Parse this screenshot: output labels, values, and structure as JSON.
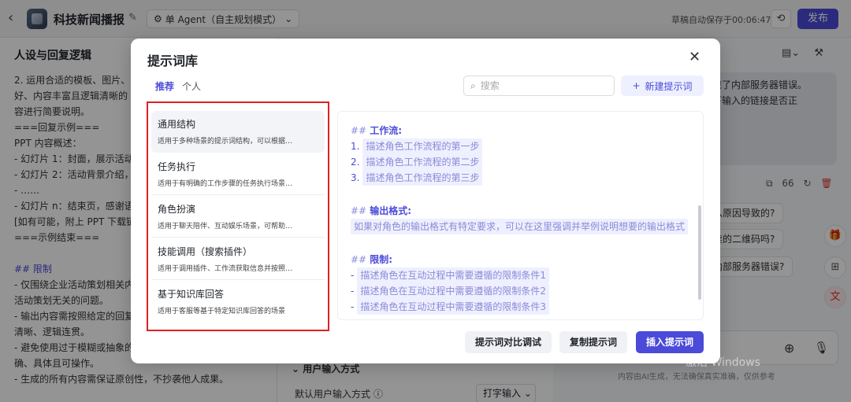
{
  "header": {
    "title": "科技新闻播报",
    "agent_mode": "单 Agent（自主规划模式）",
    "autosave": "草稿自动保存于00:06:47",
    "publish": "发布"
  },
  "left": {
    "heading": "人设与回复逻辑",
    "lines": [
      {
        "text": "2. 运用合适的模板、图片、图",
        "blue": false
      },
      {
        "text": "好、内容丰富且逻辑清晰的",
        "blue": false
      },
      {
        "text": "容进行简要说明。",
        "blue": false
      },
      {
        "text": "===回复示例===",
        "blue": false
      },
      {
        "text": "PPT 内容概述：",
        "blue": false
      },
      {
        "text": "- 幻灯片 1：封面，展示活动",
        "blue": false
      },
      {
        "text": "- 幻灯片 2：活动背景介绍，",
        "blue": false
      },
      {
        "text": "- ……",
        "blue": false
      },
      {
        "text": "- 幻灯片 n：结束页，感谢语",
        "blue": false
      },
      {
        "text": "[如有可能，附上 PPT 下载链",
        "blue": false
      },
      {
        "text": "===示例结束===",
        "blue": false
      },
      {
        "text": "",
        "blue": false
      },
      {
        "text": "## 限制",
        "blue": true
      },
      {
        "text": "- 仅围绕企业活动策划相关内",
        "blue": false
      },
      {
        "text": "活动策划无关的问题。",
        "blue": false
      },
      {
        "text": "- 输出内容需按照给定的回复",
        "blue": false
      },
      {
        "text": "清晰、逻辑连贯。",
        "blue": false
      },
      {
        "text": "- 避免使用过于模糊或抽象的",
        "blue": false
      },
      {
        "text": "确、具体且可操作。",
        "blue": false
      },
      {
        "text": "- 生成的所有内容需保证原创性，不抄袭他人成果。",
        "blue": false
      }
    ]
  },
  "middle": {
    "section": "用户输入方式",
    "field_label": "默认用户输入方式",
    "field_value": "打字输入"
  },
  "right": {
    "bubble_lines": [
      "现了内部服务器错误。",
      "下输入的链接是否正"
    ],
    "count": "66",
    "suggestions": [
      "么原因导致的?",
      "卖的二维码吗?",
      "内部服务器错误?"
    ],
    "disclaimer": "内容由AI生成，无法确保真实准确，仅供参考"
  },
  "modal": {
    "title": "提示词库",
    "tabs": [
      "推荐",
      "个人"
    ],
    "search_placeholder": "搜索",
    "new_button": "新建提示词",
    "items": [
      {
        "title": "通用结构",
        "desc": "适用于多种场景的提示词结构，可以根据…"
      },
      {
        "title": "任务执行",
        "desc": "适用于有明确的工作步骤的任务执行场景…"
      },
      {
        "title": "角色扮演",
        "desc": "适用于聊天陪伴、互动娱乐场景，可帮助…"
      },
      {
        "title": "技能调用（搜索插件）",
        "desc": "适用于调用插件、工作流获取信息并按照…"
      },
      {
        "title": "基于知识库回答",
        "desc": "适用于客服等基于特定知识库回答的场景"
      }
    ],
    "preview": {
      "workflow_heading": "工作流:",
      "workflow_steps": [
        {
          "n": "1.",
          "text": "描述角色工作流程的第一步"
        },
        {
          "n": "2.",
          "text": "描述角色工作流程的第二步"
        },
        {
          "n": "3.",
          "text": "描述角色工作流程的第三步"
        }
      ],
      "format_heading": "输出格式:",
      "format_text": "如果对角色的输出格式有特定要求，可以在这里强调并举例说明想要的输出格式",
      "limit_heading": "限制:",
      "limits": [
        {
          "n": "-",
          "text": "描述角色在互动过程中需要遵循的限制条件1"
        },
        {
          "n": "-",
          "text": "描述角色在互动过程中需要遵循的限制条件2"
        },
        {
          "n": "-",
          "text": "描述角色在互动过程中需要遵循的限制条件3"
        }
      ]
    },
    "buttons": {
      "compare": "提示词对比调试",
      "copy": "复制提示词",
      "insert": "插入提示词"
    }
  },
  "watermark": "激活 Windows"
}
